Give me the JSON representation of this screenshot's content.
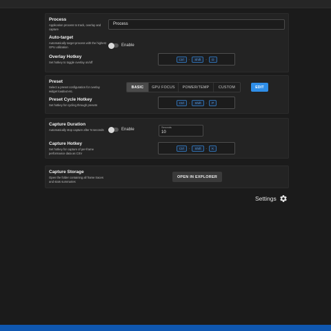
{
  "process": {
    "title": "Process",
    "desc": "Application process to track, overlay and capture",
    "value": "Process"
  },
  "auto_target": {
    "title": "Auto-target",
    "desc": "Automatically target process with the highest GPU utilization",
    "toggle_label": "Enable",
    "enabled": false
  },
  "overlay_hotkey": {
    "title": "Overlay Hotkey",
    "desc": "Set hotkey to toggle overlay on/off",
    "keys": [
      "Ctrl",
      "Shift",
      "O"
    ]
  },
  "preset": {
    "title": "Preset",
    "desc": "Select a preset configuration for overlay widget loadout etc.",
    "options": [
      "BASIC",
      "GPU FOCUS",
      "POWER/TEMP",
      "CUSTOM"
    ],
    "selected": "BASIC",
    "edit_label": "EDIT"
  },
  "preset_cycle_hotkey": {
    "title": "Preset Cycle Hotkey",
    "desc": "Set hotkey for cycling through presets",
    "keys": [
      "Ctrl",
      "Shift",
      "P"
    ]
  },
  "capture_duration": {
    "title": "Capture Duration",
    "desc": "Automatically stop capture after N seconds",
    "toggle_label": "Enable",
    "enabled": false,
    "field_caption": "Seconds",
    "field_value": "10"
  },
  "capture_hotkey": {
    "title": "Capture Hotkey",
    "desc": "Set hotkey for capture of per-frame performance data as CSV",
    "keys": [
      "Ctrl",
      "Shift",
      "K"
    ]
  },
  "capture_storage": {
    "title": "Capture Storage",
    "desc": "Open the folder containing all frame traces and stats summaries",
    "button_label": "OPEN IN EXPLORER"
  },
  "settings": {
    "label": "Settings",
    "icon": "gear-icon"
  },
  "colors": {
    "accent": "#2f8ee8",
    "bottom_bar": "#0f57b0",
    "background": "#1b1b1b",
    "card": "#232323"
  }
}
